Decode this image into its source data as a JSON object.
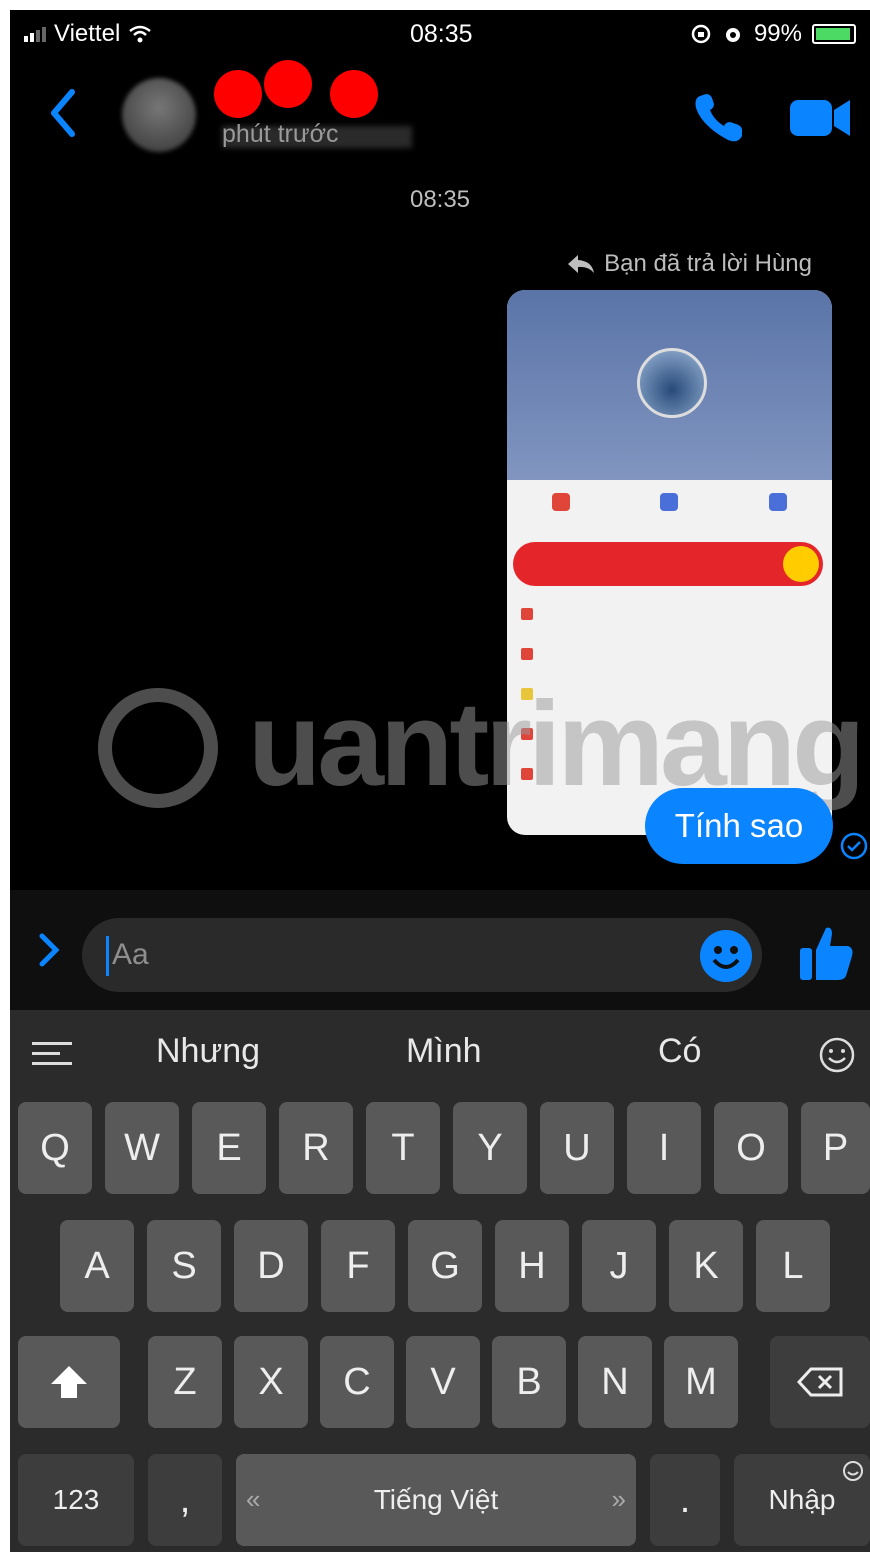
{
  "status_bar": {
    "carrier": "Viettel",
    "time": "08:35",
    "battery": "99%"
  },
  "header": {
    "subtitle": "phút trước"
  },
  "conversation": {
    "timestamp": "08:35",
    "reply_note": "Bạn đã trả lời Hùng",
    "message": "Tính sao"
  },
  "watermark": "uantrimang",
  "composer": {
    "placeholder": "Aa"
  },
  "keyboard": {
    "suggestions": [
      "Nhưng",
      "Mình",
      "Có"
    ],
    "row1": [
      "Q",
      "W",
      "E",
      "R",
      "T",
      "Y",
      "U",
      "I",
      "O",
      "P"
    ],
    "row2": [
      "A",
      "S",
      "D",
      "F",
      "G",
      "H",
      "J",
      "K",
      "L"
    ],
    "row3": [
      "Z",
      "X",
      "C",
      "V",
      "B",
      "N",
      "M"
    ],
    "numbers_key": "123",
    "comma_key": ",",
    "space_label": "Tiếng Việt",
    "period_key": ".",
    "return_key": "Nhập"
  },
  "colors": {
    "accent": "#0a84ff",
    "bubble": "#0a84ff",
    "background": "#000000",
    "keyboard": "#2b2b2b",
    "avatar_mask": "#ff0000"
  }
}
